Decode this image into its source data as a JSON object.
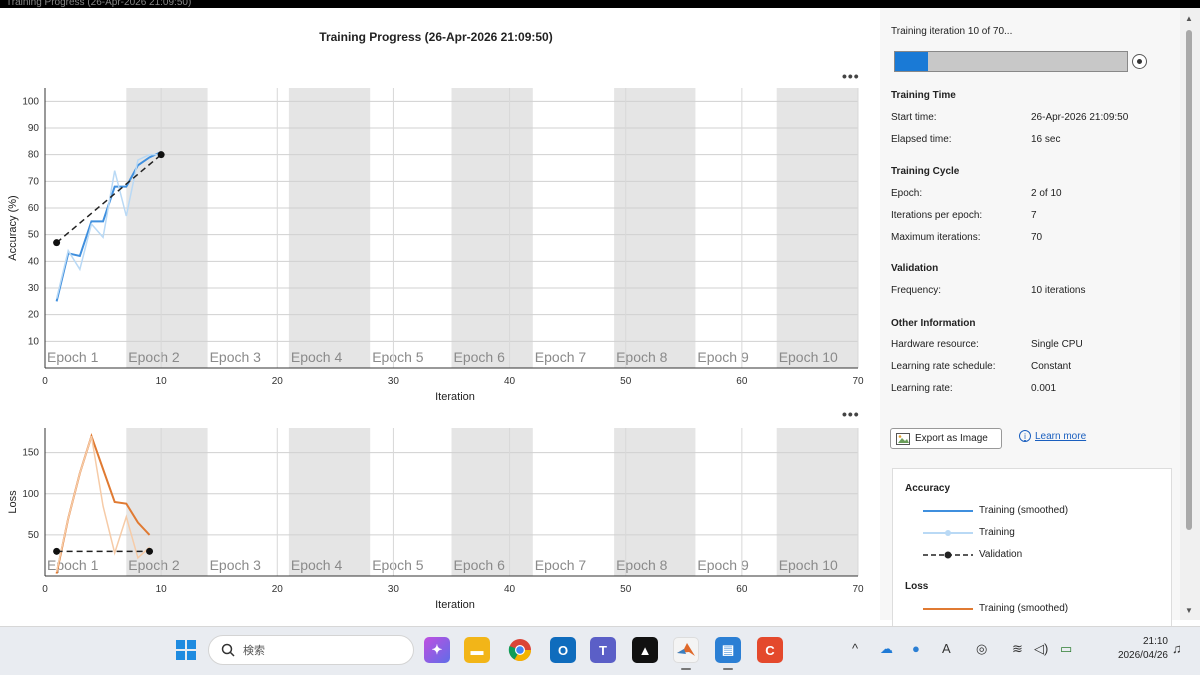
{
  "window": {
    "title": "Training Progress (26-Apr-2026 21:09:50)"
  },
  "plot": {
    "title": "Training Progress (26-Apr-2026 21:09:50)",
    "menu_label": "•••",
    "epoch_labels": [
      "Epoch 1",
      "Epoch 2",
      "Epoch 3",
      "Epoch 4",
      "Epoch 5",
      "Epoch 6",
      "Epoch 7",
      "Epoch 8",
      "Epoch 9",
      "Epoch 10"
    ],
    "iterations_per_epoch": 7
  },
  "chart_data": [
    {
      "type": "line",
      "ylabel": "Accuracy (%)",
      "xlabel": "Iteration",
      "xlim": [
        0,
        70
      ],
      "ylim": [
        0,
        105
      ],
      "xticks": [
        0,
        10,
        20,
        30,
        40,
        50,
        60,
        70
      ],
      "yticks": [
        10,
        20,
        30,
        40,
        50,
        60,
        70,
        80,
        90,
        100
      ],
      "grid": true,
      "series": [
        {
          "name": "Training (smoothed)",
          "color": "#3f8fde",
          "x": [
            1,
            2,
            3,
            4,
            5,
            6,
            7,
            8,
            9,
            10
          ],
          "y": [
            25,
            43,
            42,
            55,
            55,
            68,
            68,
            76,
            79,
            81
          ]
        },
        {
          "name": "Training",
          "color": "#b9d9f5",
          "x": [
            1,
            2,
            3,
            4,
            5,
            6,
            7,
            8,
            9,
            10
          ],
          "y": [
            26,
            44,
            37,
            54,
            49,
            74,
            57,
            78,
            80,
            80
          ]
        },
        {
          "name": "Validation",
          "color": "#222222",
          "x": [
            1,
            10
          ],
          "y": [
            47,
            80
          ]
        }
      ]
    },
    {
      "type": "line",
      "ylabel": "Loss",
      "xlabel": "Iteration",
      "xlim": [
        0,
        70
      ],
      "ylim": [
        0,
        180
      ],
      "xticks": [
        0,
        10,
        20,
        30,
        40,
        50,
        60,
        70
      ],
      "yticks": [
        50,
        100,
        150
      ],
      "grid": true,
      "series": [
        {
          "name": "Training (smoothed)",
          "color": "#e07a32",
          "x": [
            1,
            2,
            3,
            4,
            5,
            6,
            7,
            8,
            9
          ],
          "y": [
            3,
            70,
            125,
            170,
            130,
            90,
            88,
            65,
            50
          ]
        },
        {
          "name": "Training",
          "color": "#f6cba7",
          "x": [
            1,
            2,
            3,
            4,
            5,
            6,
            7,
            8,
            9
          ],
          "y": [
            5,
            70,
            125,
            170,
            85,
            28,
            72,
            22,
            35
          ]
        },
        {
          "name": "Validation",
          "color": "#222222",
          "x": [
            1,
            9
          ],
          "y": [
            30,
            30
          ]
        }
      ]
    }
  ],
  "progress": {
    "status": "Training iteration 10 of 70...",
    "fraction": 0.143
  },
  "info": {
    "training_time_title": "Training Time",
    "start_label": "Start time:",
    "start_value": "26-Apr-2026 21:09:50",
    "elapsed_label": "Elapsed time:",
    "elapsed_value": "16 sec",
    "cycle_title": "Training Cycle",
    "epoch_label": "Epoch:",
    "epoch_value": "2 of 10",
    "ipe_label": "Iterations per epoch:",
    "ipe_value": "7",
    "maxit_label": "Maximum iterations:",
    "maxit_value": "70",
    "validation_title": "Validation",
    "freq_label": "Frequency:",
    "freq_value": "10 iterations",
    "other_title": "Other Information",
    "hw_label": "Hardware resource:",
    "hw_value": "Single CPU",
    "lrs_label": "Learning rate schedule:",
    "lrs_value": "Constant",
    "lr_label": "Learning rate:",
    "lr_value": "0.001"
  },
  "actions": {
    "export_label": "Export as Image",
    "learn_more_label": "Learn more"
  },
  "legend": {
    "accuracy_title": "Accuracy",
    "acc_smoothed": "Training (smoothed)",
    "acc_training": "Training",
    "acc_validation": "Validation",
    "loss_title": "Loss",
    "loss_smoothed": "Training (smoothed)"
  },
  "taskbar": {
    "search_placeholder": "検索",
    "time": "21:10",
    "date": "2026/04/26",
    "apps": [
      "windows-start",
      "copilot",
      "file-explorer",
      "chrome",
      "outlook",
      "teams",
      "capcut",
      "matlab",
      "task-manager",
      "app-c"
    ]
  }
}
